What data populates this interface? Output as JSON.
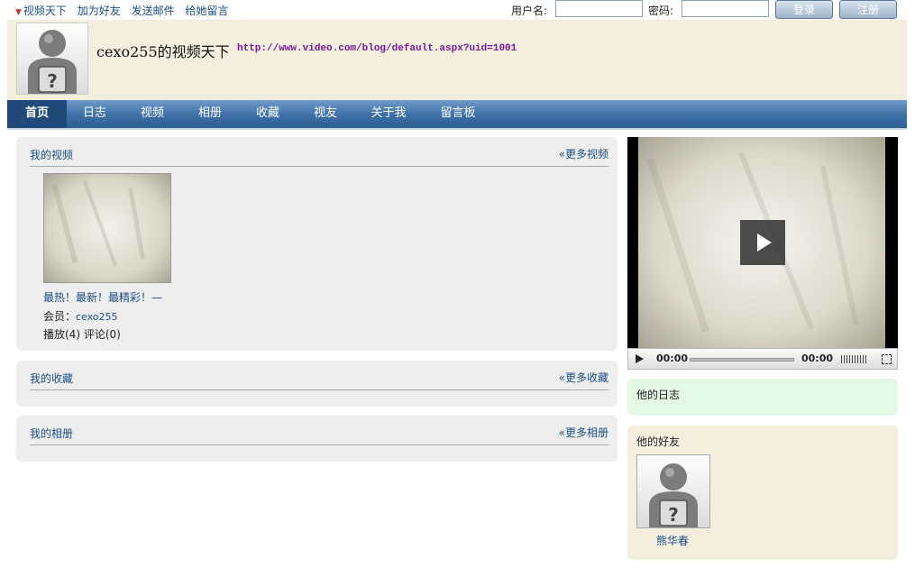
{
  "topbar": {
    "links": [
      "视频天下",
      "加为好友",
      "发送邮件",
      "给她留言"
    ],
    "username_label": "用户名:",
    "password_label": "密码:",
    "username_value": "",
    "password_value": "",
    "login_label": "登录",
    "register_label": "注册"
  },
  "header": {
    "title": "cexo255的视频天下",
    "url": "http://www.video.com/blog/default.aspx?uid=1001",
    "avatar_icon": "unknown-user-icon"
  },
  "nav": {
    "items": [
      "首页",
      "日志",
      "视频",
      "相册",
      "收藏",
      "视友",
      "关于我",
      "留言板"
    ],
    "active": "首页"
  },
  "videos": {
    "title": "我的视频",
    "more": "«更多视频",
    "items": [
      {
        "title": "最热！最新！最精彩！—",
        "member_label": "会员：",
        "member": "cexo255",
        "plays_text": "播放(4) 评论(0)"
      }
    ]
  },
  "favorites": {
    "title": "我的收藏",
    "more": "«更多收藏"
  },
  "albums": {
    "title": "我的相册",
    "more": "«更多相册"
  },
  "player": {
    "current_time": "00:00",
    "duration": "00:00",
    "progress": 0
  },
  "sidebar": {
    "diary_title": "他的日志",
    "friends_title": "他的好友",
    "friends": [
      {
        "name": "熊华春"
      }
    ]
  },
  "colors": {
    "link": "#1a4f86",
    "nav_bg": "#3d6fa6",
    "header_bg": "#f3eedd",
    "url_color": "#7a1a9a"
  }
}
